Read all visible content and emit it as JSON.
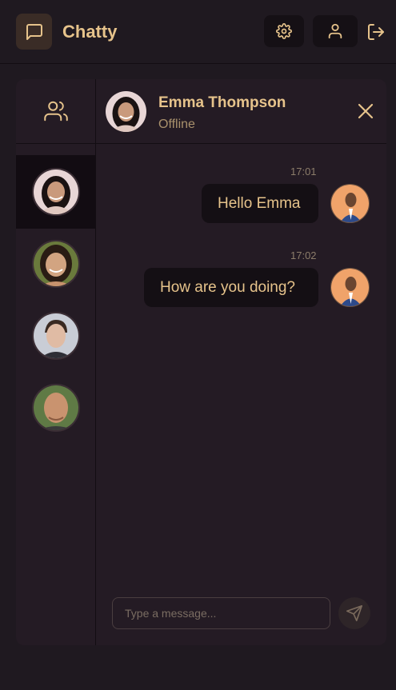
{
  "app": {
    "title": "Chatty"
  },
  "navbar": {
    "logo_icon": "message-square-icon",
    "settings_icon": "gear-icon",
    "profile_icon": "user-icon",
    "logout_icon": "logout-icon"
  },
  "sidebar": {
    "header_icon": "users-icon",
    "contacts": [
      {
        "name": "Emma Thompson",
        "active": true,
        "skin": "#c99a7c",
        "hair": "#1a1212",
        "bg": "#e8d6d6"
      },
      {
        "name": "",
        "active": false,
        "skin": "#d2a481",
        "hair": "#2a1c14",
        "bg": "#6a7a3c"
      },
      {
        "name": "",
        "active": false,
        "skin": "#e0bba4",
        "hair": "#3a2a22",
        "bg": "#c9cdd6"
      },
      {
        "name": "",
        "active": false,
        "skin": "#c9936f",
        "hair": "#9a6a50",
        "bg": "#5f7a45"
      }
    ]
  },
  "chat": {
    "contact_name": "Emma Thompson",
    "contact_status": "Offline",
    "close_icon": "close-icon",
    "messages": [
      {
        "time": "17:01",
        "text": "Hello Emma"
      },
      {
        "time": "17:02",
        "text": "How are you doing?"
      }
    ],
    "input_placeholder": "Type a message...",
    "send_icon": "send-icon"
  },
  "colors": {
    "background": "#1f1920",
    "panel": "#241b24",
    "accent": "#e6c38b",
    "bubble": "#140f14"
  }
}
